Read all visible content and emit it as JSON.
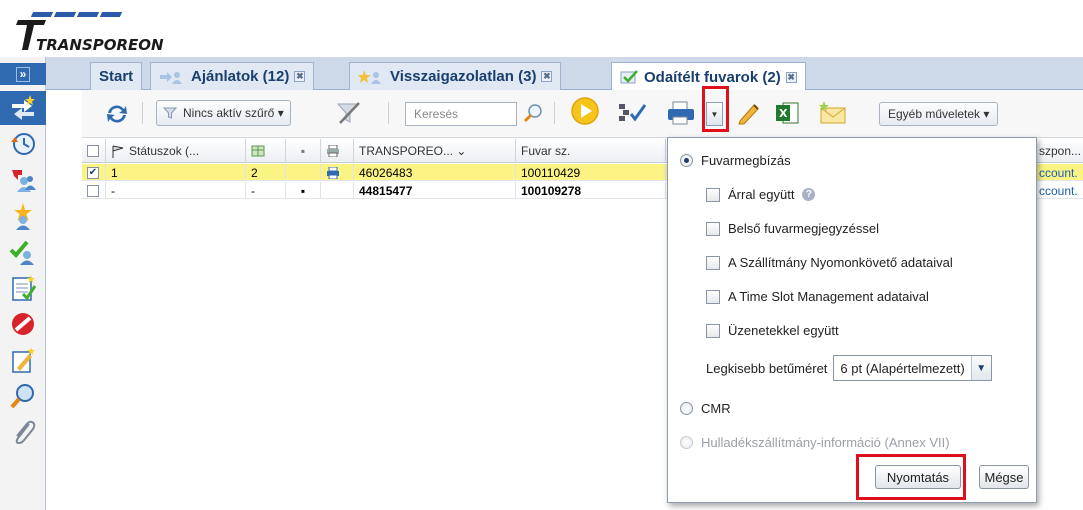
{
  "brand": {
    "name": "TRANSPOREON"
  },
  "sidebar": {
    "expand_label": "»",
    "items": [
      {
        "icon": "swap-arrows-star-icon"
      },
      {
        "icon": "history-clock-icon"
      },
      {
        "icon": "assign-users-arrow-icon"
      },
      {
        "icon": "new-offers-star-icon"
      },
      {
        "icon": "confirmed-users-check-icon"
      },
      {
        "icon": "document-checklist-icon"
      },
      {
        "icon": "no-entry-icon"
      },
      {
        "icon": "edit-document-star-icon"
      },
      {
        "icon": "search-magnifier-icon"
      },
      {
        "icon": "paperclip-icon"
      }
    ]
  },
  "tabs": [
    {
      "label": "Start",
      "closable": false
    },
    {
      "label": "Ajánlatok (12)",
      "closable": true
    },
    {
      "label": "Visszaigazolatlan (3)",
      "closable": true
    },
    {
      "label": "Odaítélt fuvarok (2)",
      "closable": true,
      "active": true
    }
  ],
  "tab_close_glyph": "✖",
  "toolbar": {
    "filter_label": "Nincs aktív szűrő ▾",
    "search_placeholder": "Keresés",
    "more_actions_label": "Egyéb műveletek ▾",
    "print_dropdown_glyph": "▼"
  },
  "grid": {
    "columns": [
      {
        "label": ""
      },
      {
        "label": "Státuszok (..."
      },
      {
        "label": ""
      },
      {
        "label": "▪"
      },
      {
        "label": ""
      },
      {
        "label": "TRANSPOREO... ⌄"
      },
      {
        "label": "Fuvar sz."
      },
      {
        "label": "szpon..."
      }
    ],
    "rows": [
      {
        "checked": true,
        "check_glyph": "✔",
        "status": "1",
        "count": "2",
        "flag": "",
        "printed": true,
        "transporeon_id": "46026483",
        "fuvar_sz": "100110429",
        "account": "ccount.",
        "selected": true
      },
      {
        "checked": false,
        "check_glyph": "",
        "status": "-",
        "count": "-",
        "flag": "▪",
        "printed": false,
        "transporeon_id": "44815477",
        "fuvar_sz": "100109278",
        "account": "ccount.",
        "selected": false
      }
    ]
  },
  "print_dialog": {
    "option_main": "Fuvarmegbízás",
    "checkboxes": [
      "Árral együtt",
      "Belső fuvarmegjegyzéssel",
      "A Szállítmány Nyomonkövető adataival",
      "A Time Slot Management adataival",
      "Üzenetekkel együtt"
    ],
    "help_glyph": "?",
    "font_size_label": "Legkisebb betűméret",
    "font_size_value": "6 pt (Alapértelmezett)",
    "font_size_arrow": "▼",
    "option_cmr": "CMR",
    "option_waste": "Hulladékszállítmány-információ (Annex VII)",
    "print_button": "Nyomtatás",
    "cancel_button": "Mégse"
  },
  "colors": {
    "accent": "#2f6ab1",
    "highlight_row": "#fbf484",
    "callout": "#e00f1c"
  }
}
